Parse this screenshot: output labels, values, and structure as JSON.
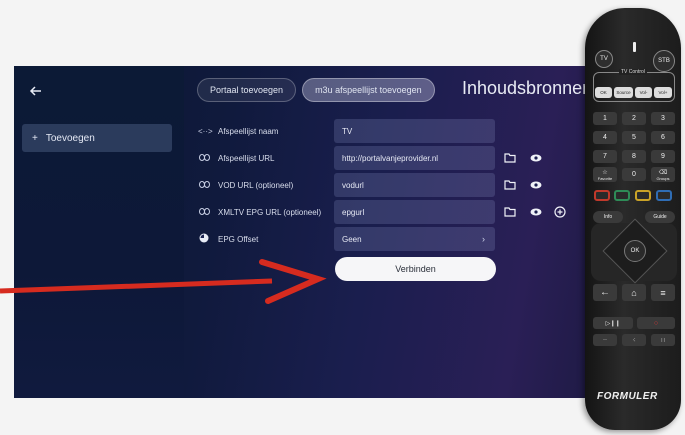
{
  "tv": {
    "sidebar": {
      "add_label": "Toevoegen",
      "add_icon": "+"
    },
    "tabs": [
      {
        "label": "Portaal toevoegen",
        "active": false
      },
      {
        "label": "m3u afspeellijst toevoegen",
        "active": true
      }
    ],
    "title": "Inhoudsbronnen",
    "rows": [
      {
        "label": "Afspeellijst naam",
        "value": "TV"
      },
      {
        "label": "Afspeellijst URL",
        "value": "http://portalvanjeprovider.nl"
      },
      {
        "label": "VOD URL (optioneel)",
        "value": "vodurl"
      },
      {
        "label": "XMLTV EPG URL (optioneel)",
        "value": "epgurl"
      },
      {
        "label": "EPG Offset",
        "value": "Geen"
      }
    ],
    "connect_label": "Verbinden"
  },
  "remote": {
    "top_labels": {
      "tv": "TV",
      "stb": "STB",
      "tv_control": "TV Control"
    },
    "source_row": [
      "OK",
      "Source",
      "Vol-",
      "Vol+"
    ],
    "keys": [
      "1",
      "2",
      "3",
      "4",
      "5",
      "6",
      "7",
      "8",
      "9",
      "☆",
      "0",
      "⌫"
    ],
    "key_sub": {
      "fav": "Favorite",
      "group": "Groups"
    },
    "info": "Info",
    "guide": "Guide",
    "ok": "OK",
    "brand": "FORMULER",
    "colors": {
      "red": "#c0392b",
      "green": "#2e8b57",
      "yellow": "#c9a227",
      "blue": "#2f6db5"
    }
  },
  "arrow_color": "#d62b1f"
}
